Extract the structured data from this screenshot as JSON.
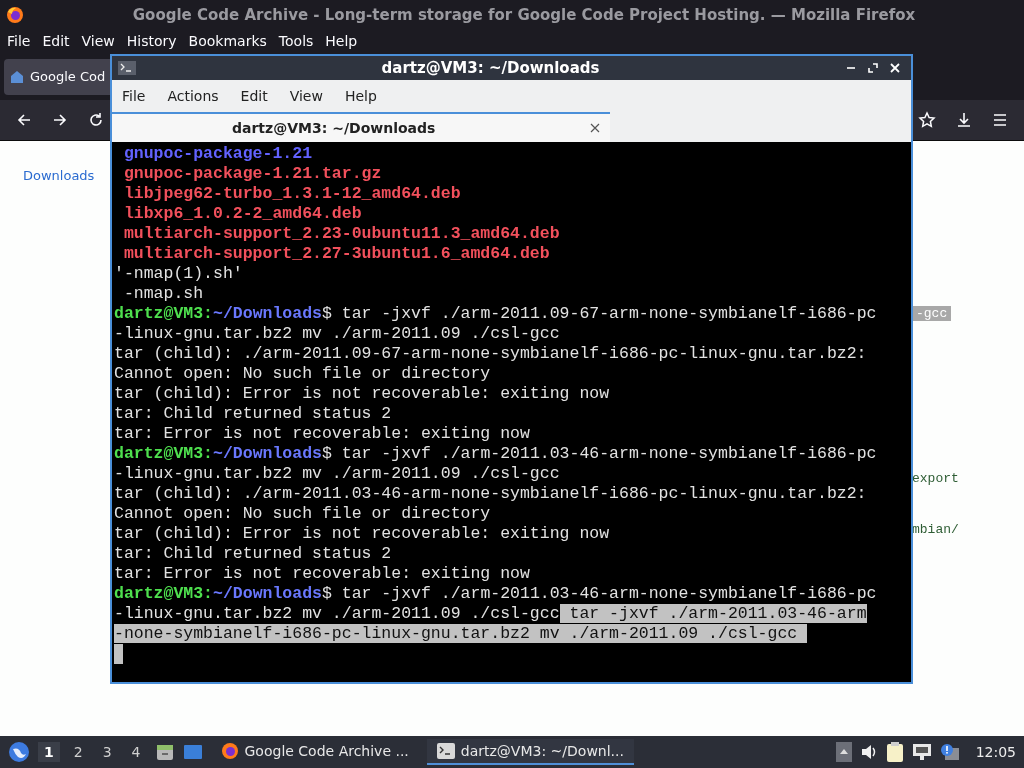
{
  "firefox": {
    "title": "Google Code Archive - Long-term storage for Google Code Project Hosting. — Mozilla Firefox",
    "menu": [
      "File",
      "Edit",
      "View",
      "History",
      "Bookmarks",
      "Tools",
      "Help"
    ],
    "tab": {
      "label": "Google Cod"
    },
    "sidebar_link": "Downloads",
    "page_fragments": [
      {
        "text": "-gcc",
        "kind": "selected"
      },
      {
        "text": "export",
        "kind": "code"
      },
      {
        "text": "mbian/",
        "kind": "code"
      }
    ]
  },
  "terminal": {
    "title": "dartz@VM3: ~/Downloads",
    "menu": [
      "File",
      "Actions",
      "Edit",
      "View",
      "Help"
    ],
    "tab": {
      "label": "dartz@VM3: ~/Downloads"
    },
    "lines": [
      [
        {
          "text": " gnupoc-package-1.21",
          "kind": "dir"
        }
      ],
      [
        {
          "text": " gnupoc-package-1.21.tar.gz",
          "kind": "archive"
        }
      ],
      [
        {
          "text": " libjpeg62-turbo_1.3.1-12_amd64.deb",
          "kind": "archive"
        }
      ],
      [
        {
          "text": " libxp6_1.0.2-2_amd64.deb",
          "kind": "archive"
        }
      ],
      [
        {
          "text": " multiarch-support_2.23-0ubuntu11.3_amd64.deb",
          "kind": "archive"
        }
      ],
      [
        {
          "text": " multiarch-support_2.27-3ubuntu1.6_amd64.deb",
          "kind": "archive"
        }
      ],
      [
        {
          "text": "'-nmap(1).sh'",
          "kind": "plain"
        }
      ],
      [
        {
          "text": " -nmap.sh",
          "kind": "plain"
        }
      ],
      [
        {
          "text": "dartz@VM3:",
          "kind": "user"
        },
        {
          "text": "~/Downloads",
          "kind": "path"
        },
        {
          "text": "$ tar -jxvf ./arm-2011.09-67-arm-none-symbianelf-i686-pc",
          "kind": "plain"
        }
      ],
      [
        {
          "text": "-linux-gnu.tar.bz2 mv ./arm-2011.09 ./csl-gcc",
          "kind": "plain"
        }
      ],
      [
        {
          "text": "tar (child): ./arm-2011.09-67-arm-none-symbianelf-i686-pc-linux-gnu.tar.bz2:",
          "kind": "plain"
        }
      ],
      [
        {
          "text": "Cannot open: No such file or directory",
          "kind": "plain"
        }
      ],
      [
        {
          "text": "tar (child): Error is not recoverable: exiting now",
          "kind": "plain"
        }
      ],
      [
        {
          "text": "tar: Child returned status 2",
          "kind": "plain"
        }
      ],
      [
        {
          "text": "tar: Error is not recoverable: exiting now",
          "kind": "plain"
        }
      ],
      [
        {
          "text": "dartz@VM3:",
          "kind": "user"
        },
        {
          "text": "~/Downloads",
          "kind": "path"
        },
        {
          "text": "$ tar -jxvf ./arm-2011.03-46-arm-none-symbianelf-i686-pc",
          "kind": "plain"
        }
      ],
      [
        {
          "text": "-linux-gnu.tar.bz2 mv ./arm-2011.09 ./csl-gcc",
          "kind": "plain"
        }
      ],
      [
        {
          "text": "tar (child): ./arm-2011.03-46-arm-none-symbianelf-i686-pc-linux-gnu.tar.bz2:",
          "kind": "plain"
        }
      ],
      [
        {
          "text": "Cannot open: No such file or directory",
          "kind": "plain"
        }
      ],
      [
        {
          "text": "tar (child): Error is not recoverable: exiting now",
          "kind": "plain"
        }
      ],
      [
        {
          "text": "tar: Child returned status 2",
          "kind": "plain"
        }
      ],
      [
        {
          "text": "tar: Error is not recoverable: exiting now",
          "kind": "plain"
        }
      ],
      [
        {
          "text": "dartz@VM3:",
          "kind": "user"
        },
        {
          "text": "~/Downloads",
          "kind": "path"
        },
        {
          "text": "$ tar -jxvf ./arm-2011.03-46-arm-none-symbianelf-i686-pc",
          "kind": "plain"
        }
      ],
      [
        {
          "text": "-linux-gnu.tar.bz2 mv ./arm-2011.09 ./csl-gcc",
          "kind": "plain"
        },
        {
          "text": " tar -jxvf ./arm-2011.03-46-arm",
          "kind": "selected"
        }
      ],
      [
        {
          "text": "-none-symbianelf-i686-pc-linux-gnu.tar.bz2 mv ./arm-2011.09 ./csl-gcc ",
          "kind": "selected"
        }
      ]
    ]
  },
  "taskbar": {
    "workspaces": [
      {
        "label": "1",
        "selected": true
      },
      {
        "label": "2",
        "selected": false
      },
      {
        "label": "3",
        "selected": false
      },
      {
        "label": "4",
        "selected": false
      }
    ],
    "tasks": [
      {
        "label": "Google Code Archive ...",
        "kind": "browser",
        "selected": false
      },
      {
        "label": "dartz@VM3: ~/Downl...",
        "kind": "terminal",
        "selected": true
      }
    ],
    "clock": "12:05"
  }
}
